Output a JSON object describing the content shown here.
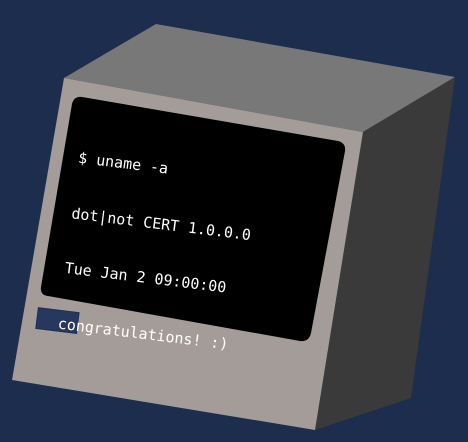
{
  "terminal": {
    "lines": [
      "$ uname -a",
      "dot|not CERT 1.0.0.0",
      "Tue Jan 2 09:00:00",
      "congratulations! :)"
    ]
  },
  "colors": {
    "background": "#1c2d4e",
    "case_front": "#a39c98",
    "case_top": "#797878",
    "case_side": "#3a3a3a",
    "screen": "#000000",
    "terminal_text": "#ffffff",
    "disk_slot": "#27385e"
  }
}
